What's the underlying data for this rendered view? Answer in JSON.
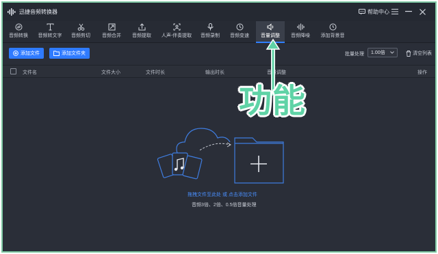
{
  "app": {
    "title": "迅捷音频转换器"
  },
  "window": {
    "help_label": "帮助中心"
  },
  "toolbar": {
    "items": [
      {
        "label": "音频转换",
        "icon": "convert-icon"
      },
      {
        "label": "音频转文字",
        "icon": "audio-to-text-icon"
      },
      {
        "label": "音频剪切",
        "icon": "scissors-icon"
      },
      {
        "label": "音频合并",
        "icon": "merge-icon"
      },
      {
        "label": "音频提取",
        "icon": "extract-icon"
      },
      {
        "label": "人声-伴奏提取",
        "icon": "vocal-separation-icon"
      },
      {
        "label": "音频录制",
        "icon": "microphone-icon"
      },
      {
        "label": "音频变速",
        "icon": "speed-icon"
      },
      {
        "label": "音量调整",
        "icon": "volume-icon"
      },
      {
        "label": "音频降噪",
        "icon": "denoise-icon"
      },
      {
        "label": "添加背景音",
        "icon": "background-music-icon"
      }
    ],
    "active_index": 8
  },
  "actions": {
    "add_file": "添加文件",
    "add_folder": "添加文件夹",
    "batch_label": "批量处理",
    "batch_value": "1.00倍",
    "clear_list": "清空列表"
  },
  "table": {
    "columns": [
      "文件名",
      "文件大小",
      "文件时长",
      "输出时长",
      "音量调整",
      "操作"
    ]
  },
  "empty_state": {
    "drop_hint": "拖拽文件至此处 或 点击添加文件",
    "description": "音频3倍、2倍、0.5倍音量处理"
  },
  "annotation": {
    "text": "功能"
  },
  "colors": {
    "accent": "#2f7bff",
    "background": "#2a2e38",
    "annotation_green": "#5fd3a6",
    "frame_border": "#7fc8a4"
  }
}
